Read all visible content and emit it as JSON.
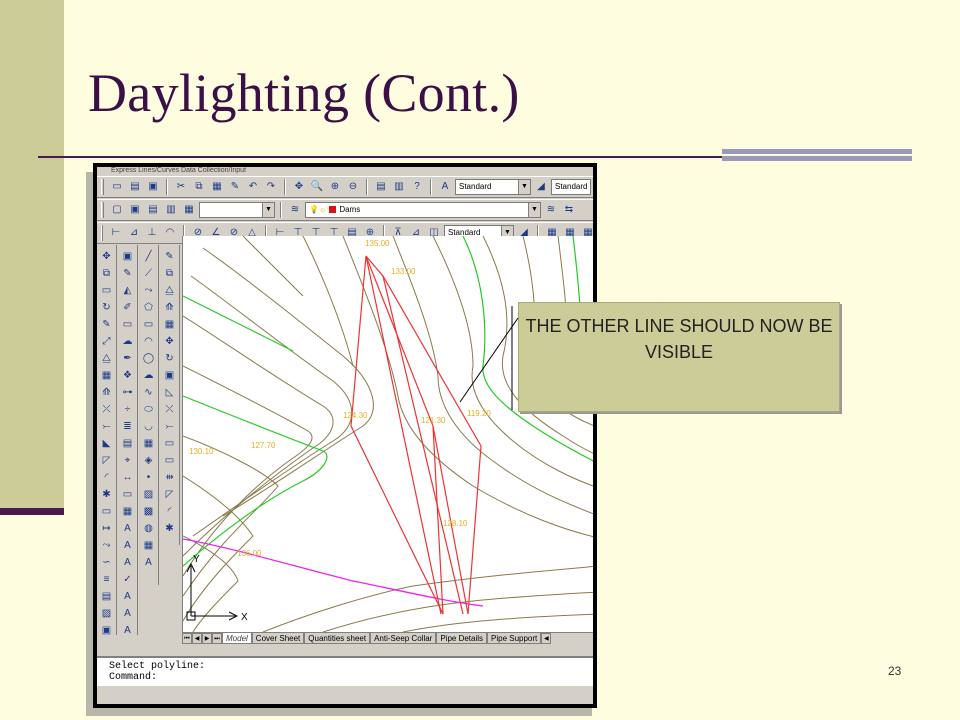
{
  "slide": {
    "title": "Daylighting (Cont.)",
    "page_number": "23",
    "callout_text": "THE OTHER LINE SHOULD NOW BE VISIBLE",
    "colors": {
      "sidebar": "#cccc99",
      "title": "#3a1046",
      "background": "#fffde0",
      "callout": "#cccc99"
    }
  },
  "app": {
    "menubar": "Express   Lines/Curves   Data Collection/Input",
    "toolbar1": {
      "text_style": "Standard",
      "dim_style": "Standard"
    },
    "toolbar2": {
      "layer": "Dams"
    },
    "toolbar3": {
      "style": "Standard"
    },
    "layout_tabs": [
      "Model",
      "Cover Sheet",
      "Quantities sheet",
      "Anti-Seep Collar",
      "Pipe Details",
      "Pipe Support"
    ],
    "command_lines": [
      "Select polyline:",
      "Command:"
    ],
    "ucs": {
      "x_label": "X",
      "y_label": "Y"
    }
  },
  "drawing_labels": [
    {
      "value": "127.70",
      "sub": "elev"
    },
    {
      "value": "130.10",
      "sub": "elev"
    },
    {
      "value": "124.30",
      "sub": "elev"
    },
    {
      "value": "121.30",
      "sub": "elev"
    },
    {
      "value": "119.20",
      "sub": "elev"
    },
    {
      "value": "128.10",
      "sub": "elev"
    },
    {
      "value": "136.00",
      "sub": "elev"
    },
    {
      "value": "135.00",
      "sub": "elev"
    },
    {
      "value": "133.00",
      "sub": "elev"
    }
  ]
}
